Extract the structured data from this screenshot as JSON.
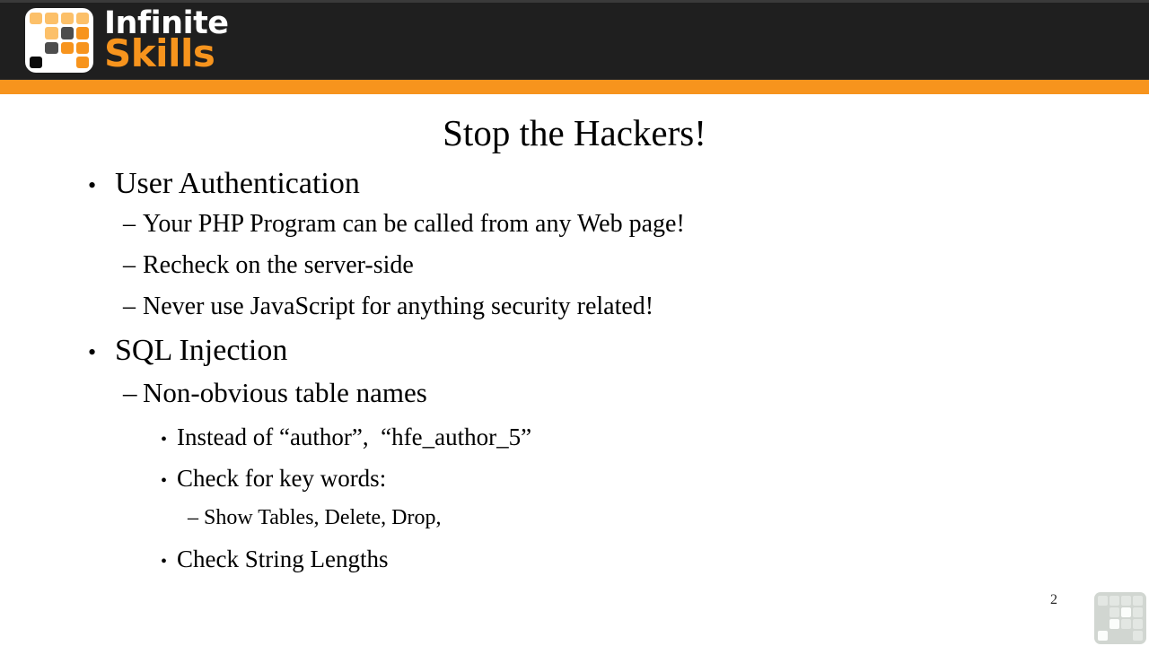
{
  "branding": {
    "logo_icon": "infinite-skills-grid-logo",
    "wordmark_line1": "Infinite",
    "wordmark_line2": "Skills",
    "header_bg": "#1f1f1f",
    "accent_orange": "#f7941d",
    "logo_tile_light_orange": "#fcc069",
    "logo_tile_orange": "#f7941d",
    "logo_tile_gray": "#4d4d4d",
    "logo_tile_black": "#0a0a0a"
  },
  "slide": {
    "title": "Stop the Hackers!",
    "page_number": "2",
    "bullets": [
      {
        "level": 1,
        "marker": "•",
        "text": "User Authentication"
      },
      {
        "level": 2,
        "marker": "–",
        "text": "Your PHP Program can be called from any Web page!"
      },
      {
        "level": 2,
        "marker": "–",
        "text": "Recheck on the server-side"
      },
      {
        "level": 2,
        "marker": "–",
        "text": "Never use JavaScript for anything security related!"
      },
      {
        "level": 1,
        "marker": "•",
        "text": "SQL Injection"
      },
      {
        "level": 2,
        "marker": "–",
        "text": "Non-obvious table names"
      },
      {
        "level": 3,
        "marker": "•",
        "text": "Instead of “author”,  “hfe_author_5”"
      },
      {
        "level": 3,
        "marker": "•",
        "text": "Check for key words:"
      },
      {
        "level": 4,
        "marker": "–",
        "text": "Show Tables, Delete, Drop,"
      },
      {
        "level": 3,
        "marker": "•",
        "text": "Check String Lengths"
      }
    ]
  },
  "footer": {
    "watermark_icon": "infinite-skills-grid-watermark"
  }
}
